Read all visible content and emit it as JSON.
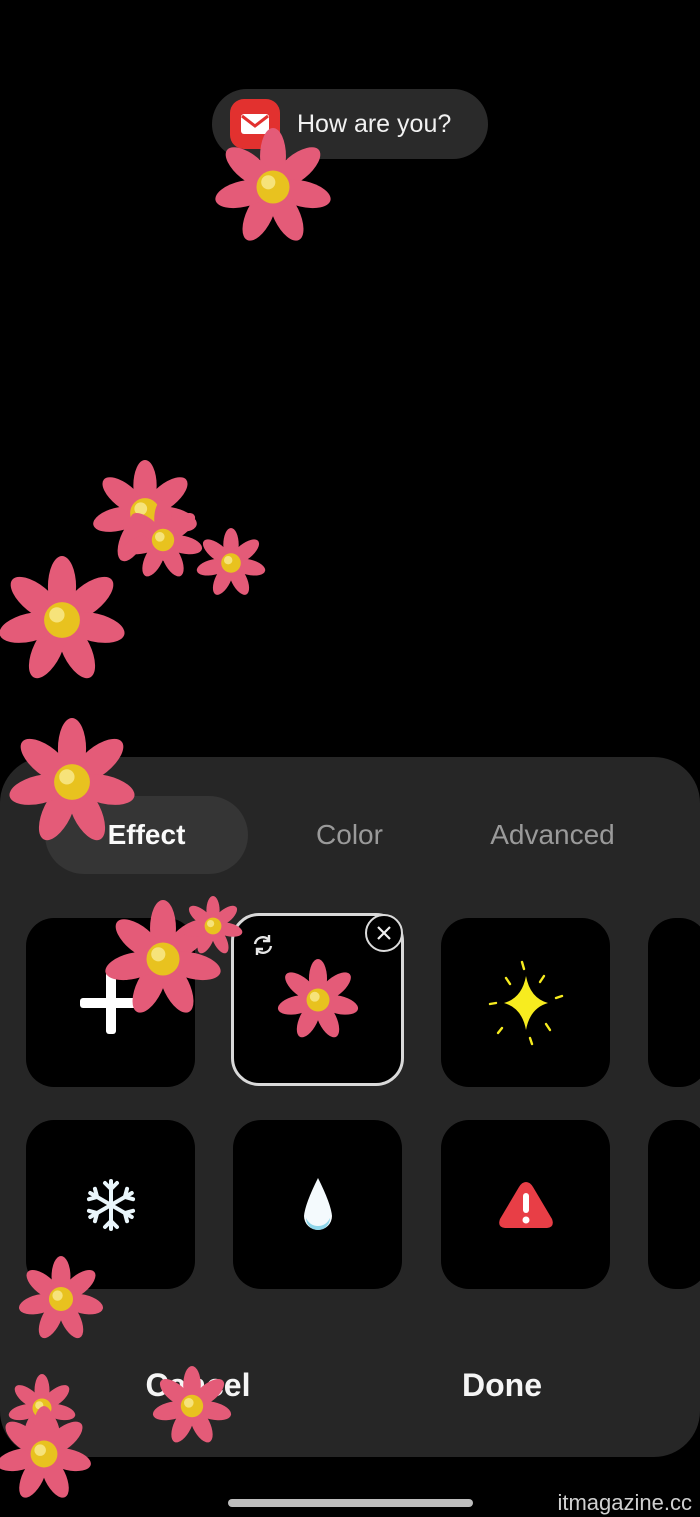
{
  "notification": {
    "text": "How are you?",
    "icon": "mail-icon",
    "icon_color": "#e2312f"
  },
  "tabs": [
    {
      "label": "Effect",
      "active": true
    },
    {
      "label": "Color",
      "active": false
    },
    {
      "label": "Advanced",
      "active": false
    }
  ],
  "effects": [
    {
      "icon": "add-icon",
      "selected": false
    },
    {
      "icon": "flower-icon",
      "selected": true
    },
    {
      "icon": "sparkle-icon",
      "selected": false
    },
    {
      "icon": "snowflake-icon",
      "selected": false
    },
    {
      "icon": "water-drop-icon",
      "selected": false
    },
    {
      "icon": "warning-icon",
      "selected": false
    }
  ],
  "buttons": {
    "cancel": "Cancel",
    "done": "Done"
  },
  "watermark": "itmagazine.cc",
  "colors": {
    "background": "#000000",
    "sheet": "#262626",
    "flower_petal": "#e45b78",
    "flower_center": "#e8c21f"
  }
}
